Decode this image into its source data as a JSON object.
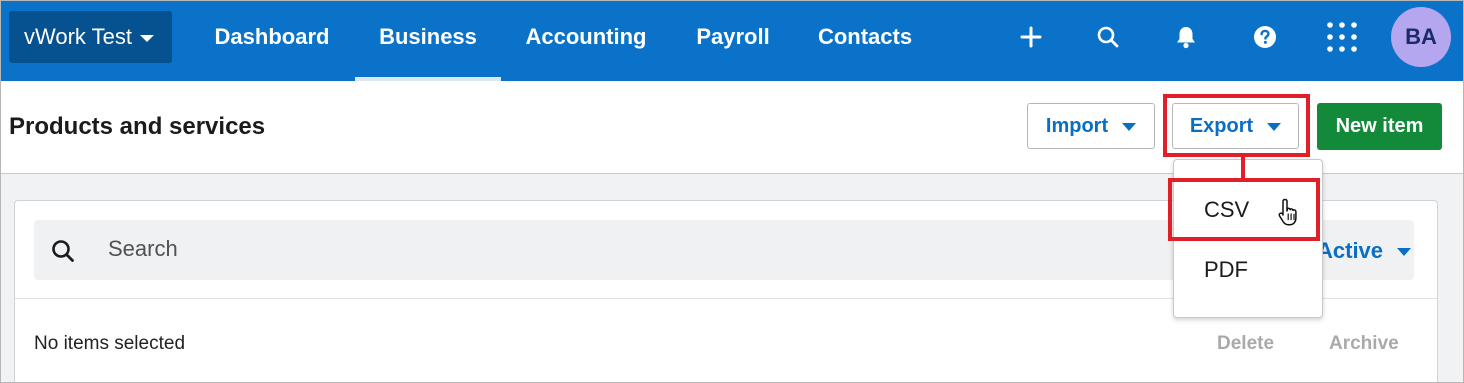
{
  "topnav": {
    "org_label": "vWork Test",
    "links": [
      {
        "label": "Dashboard"
      },
      {
        "label": "Business"
      },
      {
        "label": "Accounting"
      },
      {
        "label": "Payroll"
      },
      {
        "label": "Contacts"
      }
    ],
    "active": "Business",
    "icons": [
      "plus-icon",
      "search-icon",
      "bell-icon",
      "help-icon",
      "app-grid-icon"
    ],
    "avatar": "BA"
  },
  "header": {
    "title": "Products and services",
    "import_label": "Import",
    "export_label": "Export",
    "new_item_label": "New item"
  },
  "export_menu": {
    "items": [
      {
        "label": "CSV"
      },
      {
        "label": "PDF"
      }
    ]
  },
  "list": {
    "search_placeholder": "Search",
    "filter_label": "Active",
    "selection_status": "No items selected",
    "actions": [
      {
        "label": "Delete"
      },
      {
        "label": "Archive"
      }
    ]
  },
  "colors": {
    "nav_bg": "#0a73c9",
    "primary_green": "#138a3a",
    "link_blue": "#0a6ec4",
    "highlight_red": "#e01f26"
  }
}
